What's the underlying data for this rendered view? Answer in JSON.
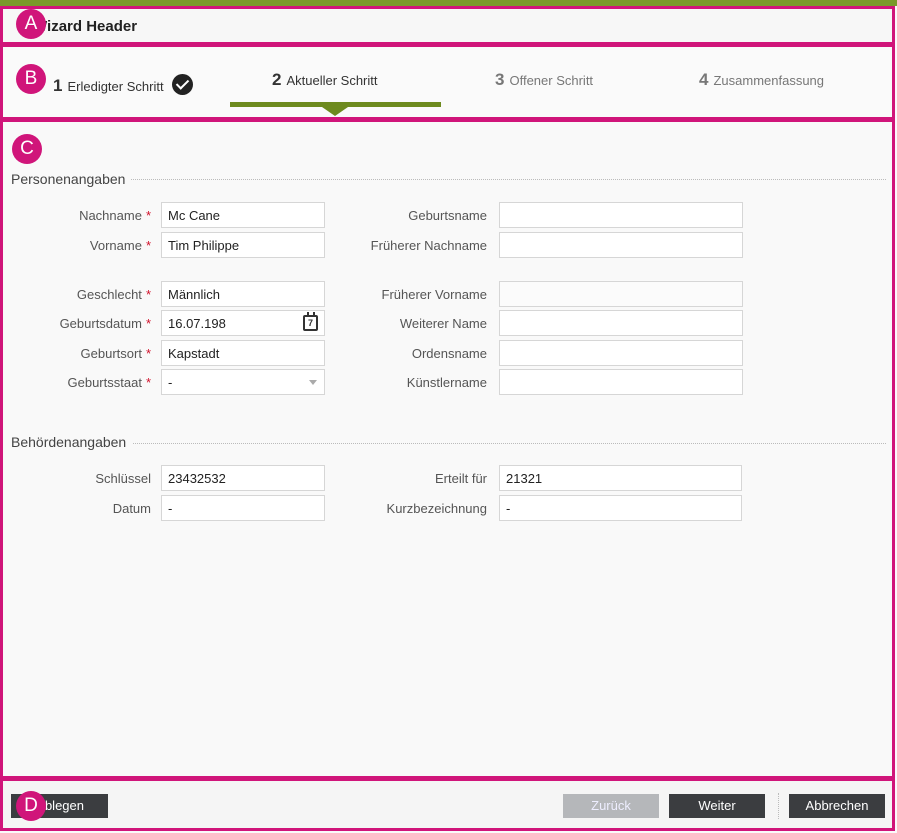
{
  "header": {
    "title": "Wizard Header"
  },
  "badges": {
    "a": "A",
    "b": "B",
    "c": "C",
    "d": "D"
  },
  "steps": [
    {
      "num": "1",
      "label": "Erledigter Schritt",
      "state": "done"
    },
    {
      "num": "2",
      "label": "Aktueller Schritt",
      "state": "active"
    },
    {
      "num": "3",
      "label": "Offener Schritt",
      "state": "open"
    },
    {
      "num": "4",
      "label": "Zusammenfassung",
      "state": "open"
    }
  ],
  "person": {
    "section_title": "Personenangaben",
    "nachname": {
      "label": "Nachname",
      "value": "Mc Cane",
      "required": "*"
    },
    "vorname": {
      "label": "Vorname",
      "value": "Tim Philippe",
      "required": "*"
    },
    "geschlecht": {
      "label": "Geschlecht",
      "value": "Männlich",
      "required": "*"
    },
    "geburtsdatum": {
      "label": "Geburtsdatum",
      "value": "16.07.198",
      "required": "*",
      "calendar_day": "7"
    },
    "geburtsort": {
      "label": "Geburtsort",
      "value": "Kapstadt",
      "required": "*"
    },
    "geburtsstaat": {
      "label": "Geburtsstaat",
      "value": "-",
      "required": "*"
    },
    "geburtsname": {
      "label": "Geburtsname",
      "value": ""
    },
    "frueherer_nachname": {
      "label": "Früherer Nachname",
      "value": ""
    },
    "frueherer_vorname": {
      "label": "Früherer Vorname",
      "value": ""
    },
    "weiterer_name": {
      "label": "Weiterer Name",
      "value": ""
    },
    "ordensname": {
      "label": "Ordensname",
      "value": ""
    },
    "kuenstlername": {
      "label": "Künstlername",
      "value": ""
    }
  },
  "authority": {
    "section_title": "Behördenangaben",
    "schluessel": {
      "label": "Schlüssel",
      "value": "23432532"
    },
    "datum": {
      "label": "Datum",
      "value": "-"
    },
    "erteilt_fuer": {
      "label": "Erteilt für",
      "value": "21321"
    },
    "kurzbezeichnung": {
      "label": "Kurzbezeichnung",
      "value": "-"
    }
  },
  "footer": {
    "ablegen": "Ablegen",
    "zurueck": "Zurück",
    "weiter": "Weiter",
    "abbrechen": "Abbrechen"
  },
  "colors": {
    "accent": "#6d8a1e",
    "annotation": "#d0157a",
    "required": "#d0102a",
    "button_dark": "#3b3d40"
  }
}
